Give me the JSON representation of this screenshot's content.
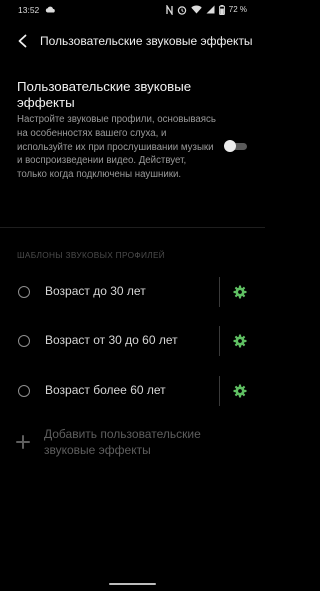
{
  "status_bar": {
    "time": "13:52",
    "battery": "72 %"
  },
  "app_bar": {
    "title": "Пользовательские звуковые эффекты"
  },
  "feature": {
    "title": "Пользовательские звуковые эффекты",
    "description": "Настройте звуковые профили, основываясь на особенностях вашего слуха, и используйте их при прослушивании музыки и воспроизведении видео. Действует, только когда подключены наушники.",
    "enabled": false
  },
  "profiles": {
    "header": "ШАБЛОНЫ ЗВУКОВЫХ ПРОФИЛЕЙ",
    "items": [
      {
        "label": "Возраст до 30 лет",
        "selected": false
      },
      {
        "label": "Возраст от 30 до 60 лет",
        "selected": false
      },
      {
        "label": "Возраст более 60 лет",
        "selected": false
      }
    ],
    "add_label": "Добавить пользовательские звуковые эффекты"
  },
  "colors": {
    "background": "#000000",
    "accent_gear": "#5fbf62",
    "toggle_off_track": "#5a5a5a"
  }
}
